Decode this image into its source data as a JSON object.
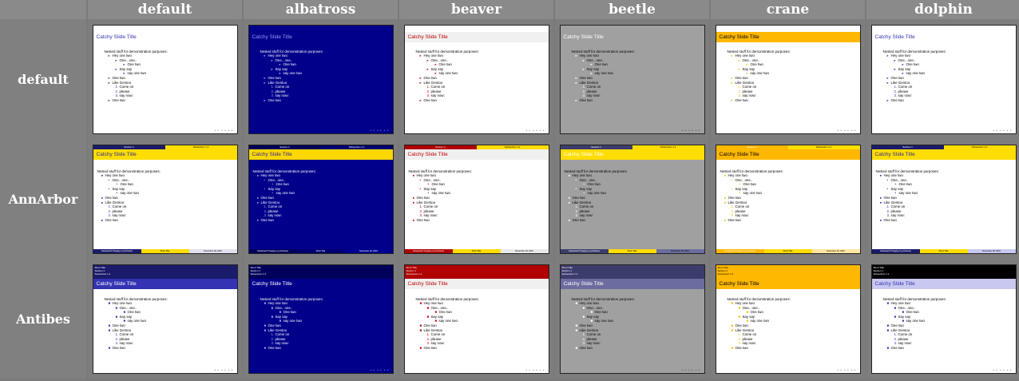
{
  "columns": [
    "default",
    "albatross",
    "beaver",
    "beetle",
    "crane",
    "dolphin"
  ],
  "rows": [
    "default",
    "AnnArbor",
    "Antibes"
  ],
  "slide": {
    "title": "Catchy Slide Title",
    "intro": "Nested stuff for demonstration purposes:",
    "items": [
      {
        "lvl": 1,
        "text": "Hey one two"
      },
      {
        "lvl": 2,
        "text": "One.. one.."
      },
      {
        "lvl": 3,
        "text": "One two"
      },
      {
        "lvl": 2,
        "text": "Say say"
      },
      {
        "lvl": 3,
        "text": "say one two"
      },
      {
        "lvl": 1,
        "text": "One two"
      },
      {
        "lvl": 1,
        "text": "Like Gentoo"
      },
      {
        "lvl": "e",
        "num": "1.",
        "text": "Come on"
      },
      {
        "lvl": "e",
        "num": "2.",
        "text": "please"
      },
      {
        "lvl": "e",
        "num": "3.",
        "text": "say now:"
      },
      {
        "lvl": 1,
        "text": "One two"
      }
    ],
    "header_section": "Section 1",
    "header_subsection": "Subsection 1.1",
    "footer_author": "SebastianP Poagbg.org (Institute)",
    "footer_title": "Short Title",
    "footer_date": "November 18, 2010",
    "footer_page": "1 / 9",
    "toc_short_title": "Short Title",
    "toc_section": "Section 1",
    "toc_subsection": "Subsection 1.1"
  },
  "themes": {
    "default": {
      "bg": "#ffffff",
      "fg": "#000000",
      "title_bg": "#ffffff",
      "title_fg": "#3333b3",
      "accent": "#3333b3",
      "bar1": "#1b1b6b",
      "bar2": "#3333b3",
      "bar3": "#e0e0ee"
    },
    "albatross": {
      "bg": "#00008b",
      "fg": "#ffffff",
      "title_bg": "#00008b",
      "title_fg": "#9a9af5",
      "accent": "#9a9af5",
      "bar1": "#00005a",
      "bar2": "#00006f",
      "bar3": "#000090"
    },
    "beaver": {
      "bg": "#ffffff",
      "fg": "#000000",
      "title_bg": "#f0f0f0",
      "title_fg": "#c00000",
      "accent": "#c00000",
      "bar1": "#b00000",
      "bar2": "#d0d0d0",
      "bar3": "#e8e8e8"
    },
    "beetle": {
      "bg": "#a0a0a0",
      "fg": "#000000",
      "title_bg": "#a0a0a0",
      "title_fg": "#ffffff",
      "accent": "#ffffff",
      "bar1": "#3c3c6c",
      "bar2": "#555590",
      "bar3": "#6c6ca0"
    },
    "crane": {
      "bg": "#ffffff",
      "fg": "#000000",
      "title_bg": "#ffb800",
      "title_fg": "#000000",
      "accent": "#ffb800",
      "bar1": "#ffb800",
      "bar2": "#ffd060",
      "bar3": "#ffe6a0"
    },
    "dolphin": {
      "bg": "#ffffff",
      "fg": "#000000",
      "title_bg": "#ffffff",
      "title_fg": "#3333b3",
      "accent": "#3333b3",
      "bar1": "#1b1b6b",
      "bar2": "#8080d8",
      "bar3": "#c8c8f0"
    }
  }
}
